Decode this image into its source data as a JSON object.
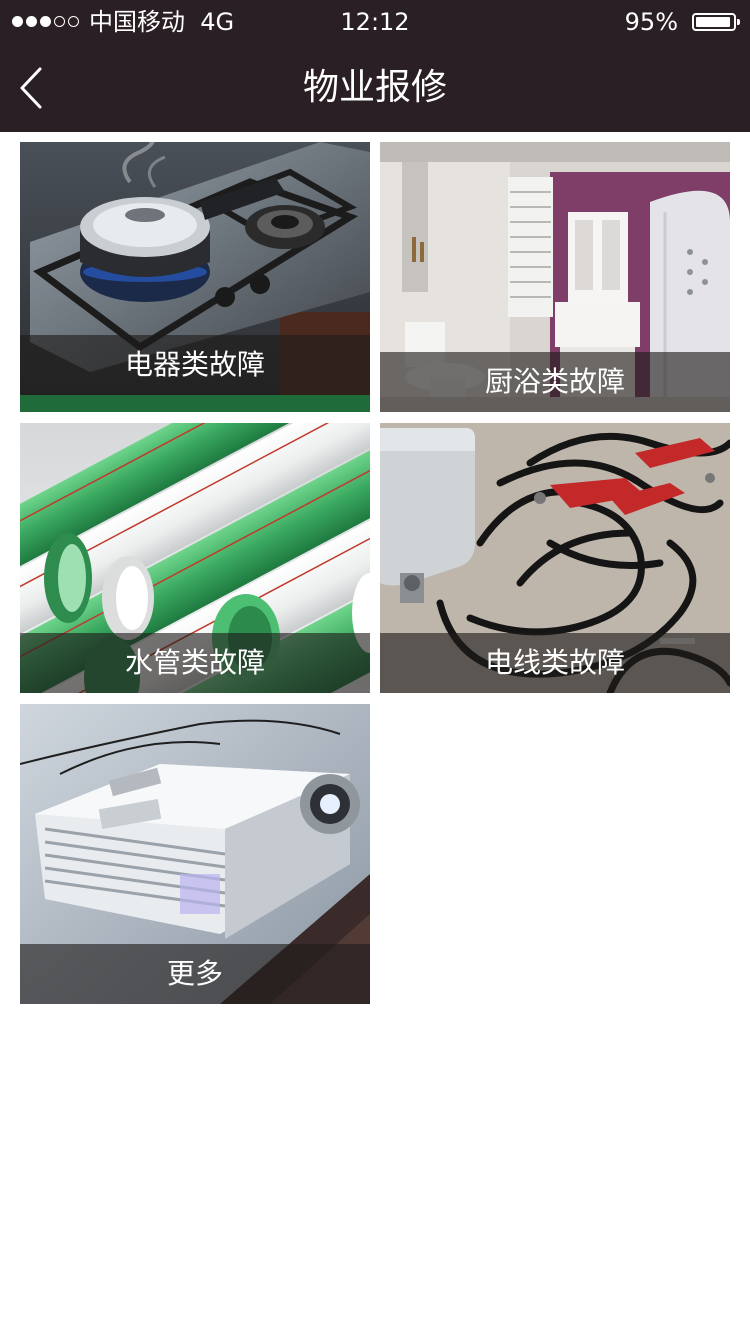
{
  "status_bar": {
    "carrier": "中国移动",
    "network": "4G",
    "time": "12:12",
    "battery_percent": "95%",
    "battery_level": 0.95,
    "signal_bars_filled": 3,
    "signal_bars_total": 5
  },
  "nav": {
    "title": "物业报修",
    "back_icon": "chevron-left-icon"
  },
  "categories": [
    {
      "label": "电器类故障",
      "image": "gas-stove-image"
    },
    {
      "label": "厨浴类故障",
      "image": "bathroom-image"
    },
    {
      "label": "水管类故障",
      "image": "water-pipes-image"
    },
    {
      "label": "电线类故障",
      "image": "electric-cables-image"
    },
    {
      "label": "更多",
      "image": "projector-image"
    }
  ],
  "colors": {
    "header_bg": "#2a1f24",
    "label_overlay": "rgba(30,28,26,0.62)"
  }
}
